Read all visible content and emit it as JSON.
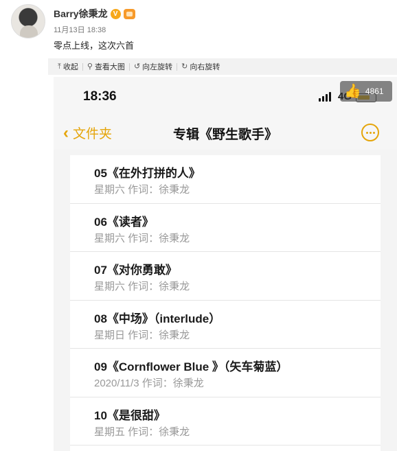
{
  "post": {
    "author": "Barry徐秉龙",
    "verified_badge": "V",
    "timestamp": "11月13日 18:38",
    "text": "零点上线，这次六首"
  },
  "toolbar": {
    "collapse": "收起",
    "view_large": "查看大图",
    "rotate_left": "向左旋转",
    "rotate_right": "向右旋转"
  },
  "phone": {
    "clock": "18:36",
    "network": "4G",
    "like_count": "4861",
    "back_label": "文件夹",
    "title": "专辑《野生歌手》"
  },
  "tracks": [
    {
      "title": "05《在外打拼的人》",
      "meta": "星期六  作词：徐秉龙"
    },
    {
      "title": "06《读者》",
      "meta": "星期六  作词：徐秉龙"
    },
    {
      "title": "07《对你勇敢》",
      "meta": "星期六  作词：徐秉龙"
    },
    {
      "title": "08《中场》（interlude）",
      "meta": "星期日  作词：徐秉龙"
    },
    {
      "title": "09《Cornflower Blue 》（矢车菊蓝）",
      "meta": "2020/11/3  作词：徐秉龙"
    },
    {
      "title": "10《是很甜》",
      "meta": "星期五  作词：徐秉龙"
    }
  ],
  "colors": {
    "accent": "#e5a50a",
    "badge": "#f7a81b"
  },
  "icons": [
    "collapse-icon",
    "zoom-icon",
    "rotate-left-icon",
    "rotate-right-icon",
    "thumbs-up-icon",
    "chevron-left-icon",
    "more-icon"
  ]
}
